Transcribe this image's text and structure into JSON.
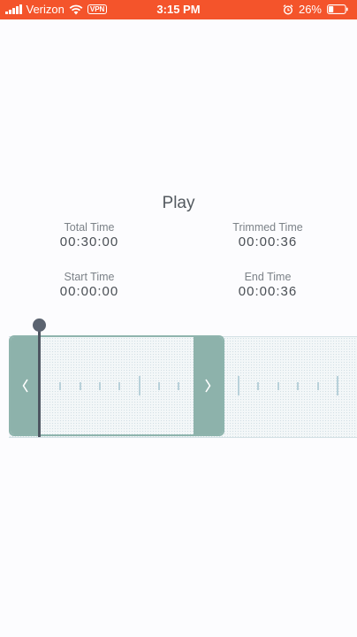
{
  "status_bar": {
    "carrier": "Verizon",
    "vpn": "VPN",
    "time": "3:15 PM",
    "battery": "26%",
    "background_color": "#f4542b"
  },
  "player": {
    "play_label": "Play"
  },
  "times": {
    "total": {
      "label": "Total Time",
      "value": "00:30:00"
    },
    "trimmed": {
      "label": "Trimmed Time",
      "value": "00:00:36"
    },
    "start": {
      "label": "Start Time",
      "value": "00:00:00"
    },
    "end": {
      "label": "End Time",
      "value": "00:00:36"
    }
  },
  "trimmer": {
    "left_handle_icon": "chevron-left-icon",
    "right_handle_icon": "chevron-right-icon",
    "handle_color": "#8db2ab",
    "playhead_color": "#4e5662"
  }
}
